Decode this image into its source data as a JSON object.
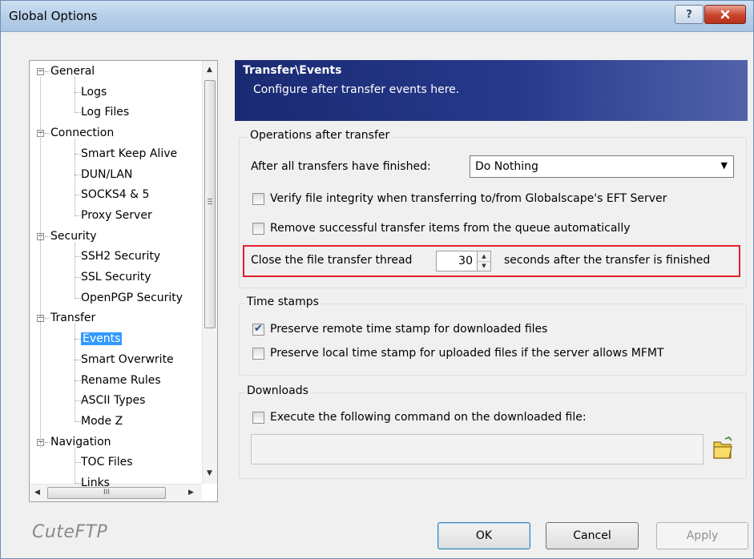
{
  "window": {
    "title": "Global Options",
    "help_label": "?",
    "close_label": "✕"
  },
  "tree": {
    "items": [
      {
        "label": "General",
        "level": 0,
        "expander": "−"
      },
      {
        "label": "Logs",
        "level": 1
      },
      {
        "label": "Log Files",
        "level": 1
      },
      {
        "label": "Connection",
        "level": 0,
        "expander": "−"
      },
      {
        "label": "Smart Keep Alive",
        "level": 1
      },
      {
        "label": "DUN/LAN",
        "level": 1
      },
      {
        "label": "SOCKS4 & 5",
        "level": 1
      },
      {
        "label": "Proxy Server",
        "level": 1
      },
      {
        "label": "Security",
        "level": 0,
        "expander": "−"
      },
      {
        "label": "SSH2 Security",
        "level": 1
      },
      {
        "label": "SSL Security",
        "level": 1
      },
      {
        "label": "OpenPGP Security",
        "level": 1
      },
      {
        "label": "Transfer",
        "level": 0,
        "expander": "−"
      },
      {
        "label": "Events",
        "level": 1,
        "selected": true
      },
      {
        "label": "Smart Overwrite",
        "level": 1
      },
      {
        "label": "Rename Rules",
        "level": 1
      },
      {
        "label": "ASCII Types",
        "level": 1
      },
      {
        "label": "Mode Z",
        "level": 1
      },
      {
        "label": "Navigation",
        "level": 0,
        "expander": "−"
      },
      {
        "label": "TOC Files",
        "level": 1
      },
      {
        "label": "Links",
        "level": 1
      }
    ],
    "scroll_thumb_label": "III"
  },
  "header": {
    "title": "Transfer\\Events",
    "subtitle": "Configure after transfer events here."
  },
  "operations": {
    "group_label": "Operations after transfer",
    "after_label": "After all transfers have finished:",
    "after_value": "Do Nothing",
    "verify_label": "Verify file integrity when transferring to/from Globalscape's EFT Server",
    "verify_checked": false,
    "remove_label": "Remove successful transfer items from the queue automatically",
    "remove_checked": false,
    "close_prefix": "Close the file transfer thread",
    "close_value": "30",
    "close_suffix": "seconds after the transfer is finished"
  },
  "timestamps": {
    "group_label": "Time stamps",
    "remote_label": "Preserve remote time stamp for downloaded files",
    "remote_checked": true,
    "local_label": "Preserve local time stamp for uploaded files if the server allows MFMT",
    "local_checked": false
  },
  "downloads": {
    "group_label": "Downloads",
    "execute_label": "Execute the following command on the downloaded file:",
    "execute_checked": false,
    "command_value": ""
  },
  "footer": {
    "brand": "CuteFTP",
    "ok_label": "OK",
    "cancel_label": "Cancel",
    "apply_label": "Apply"
  },
  "colors": {
    "header_bg": "#1a2a72",
    "selection": "#3399ff",
    "highlight_border": "#e0202c"
  }
}
